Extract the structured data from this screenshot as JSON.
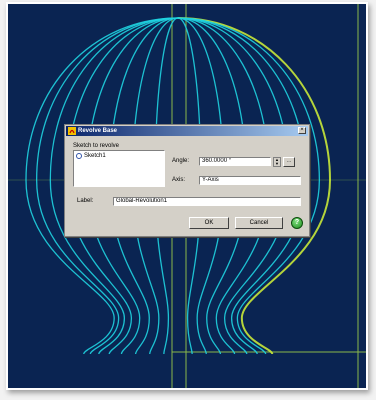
{
  "dialog": {
    "title": "Revolve Base",
    "close_glyph": "×",
    "group_label": "Sketch to revolve",
    "sketch_items": [
      "Sketch1"
    ],
    "angle_label": "Angle:",
    "angle_value": "360.0000 °",
    "axis_label": "Axis:",
    "axis_value": "Y-Axis",
    "name_label": "Label:",
    "name_value": "Global-Revolution1",
    "ok_label": "OK",
    "cancel_label": "Cancel",
    "help_glyph": "?",
    "spin_up": "▲",
    "spin_down": "▼",
    "pick_glyph": "…"
  },
  "colors": {
    "background": "#0a2452",
    "profile_lines": "#1fd3e0",
    "selected_profile": "#c8e838",
    "axis_lines": "#8bb84a"
  },
  "icons": {
    "title": "revolve-icon",
    "sketch": "sketch-icon",
    "help": "help-icon"
  }
}
